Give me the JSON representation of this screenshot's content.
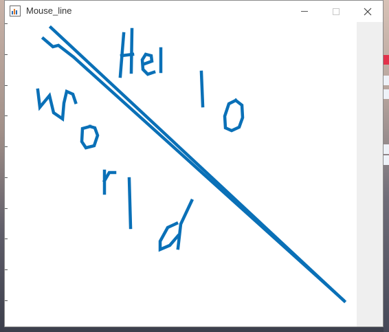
{
  "window": {
    "title": "Mouse_line",
    "controls": [
      "minimize",
      "maximize",
      "close"
    ],
    "icon": "matlab-figure-icon"
  },
  "colors": {
    "stroke": "#0a70b7",
    "canvas_background": "#ffffff",
    "side_panel": "#efefef"
  },
  "drawing": {
    "strokes": [
      "diagonal-line-1",
      "diagonal-line-2",
      "handwritten-hello",
      "handwritten-world"
    ]
  }
}
